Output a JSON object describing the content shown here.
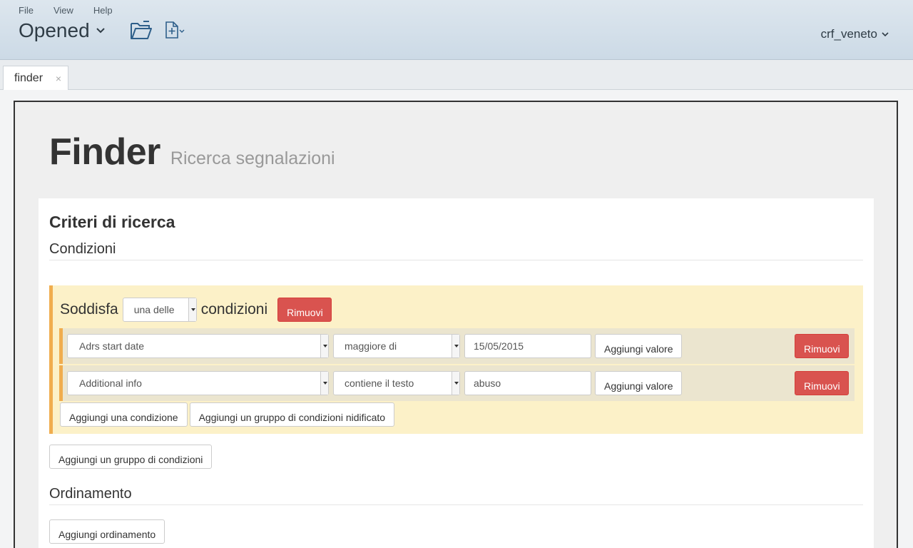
{
  "menu": [
    "File",
    "View",
    "Help"
  ],
  "app": {
    "title": "Opened",
    "user": "crf_veneto"
  },
  "tabs": [
    {
      "label": "finder",
      "close": "×"
    }
  ],
  "page": {
    "title": "Finder",
    "subtitle": "Ricerca segnalazioni"
  },
  "criteria": {
    "title": "Criteri di ricerca",
    "conditions_title": "Condizioni",
    "group": {
      "prefix": "Soddisfa",
      "match_value": "una delle",
      "suffix": "condizioni",
      "remove_label": "Rimuovi",
      "conditions": [
        {
          "field": "Adrs start date",
          "operator": "maggiore di",
          "value": "15/05/2015",
          "add_value_label": "Aggiungi valore",
          "remove_label": "Rimuovi"
        },
        {
          "field": "Additional info",
          "operator": "contiene il testo",
          "value": "abuso",
          "add_value_label": "Aggiungi valore",
          "remove_label": "Rimuovi"
        }
      ],
      "add_condition_label": "Aggiungi una condizione",
      "add_nested_group_label": "Aggiungi un gruppo di condizioni nidificato"
    },
    "add_group_label": "Aggiungi un gruppo di condizioni",
    "ordering_title": "Ordinamento",
    "add_ordering_label": "Aggiungi ordinamento"
  },
  "colors": {
    "danger": "#d9534f",
    "warning": "#f0ad4e",
    "group_bg": "#fcf1c8",
    "header_bg": "#d4e0ea"
  },
  "icons": {
    "open_folder": "folder-open-icon",
    "new_document": "new-document-icon"
  }
}
